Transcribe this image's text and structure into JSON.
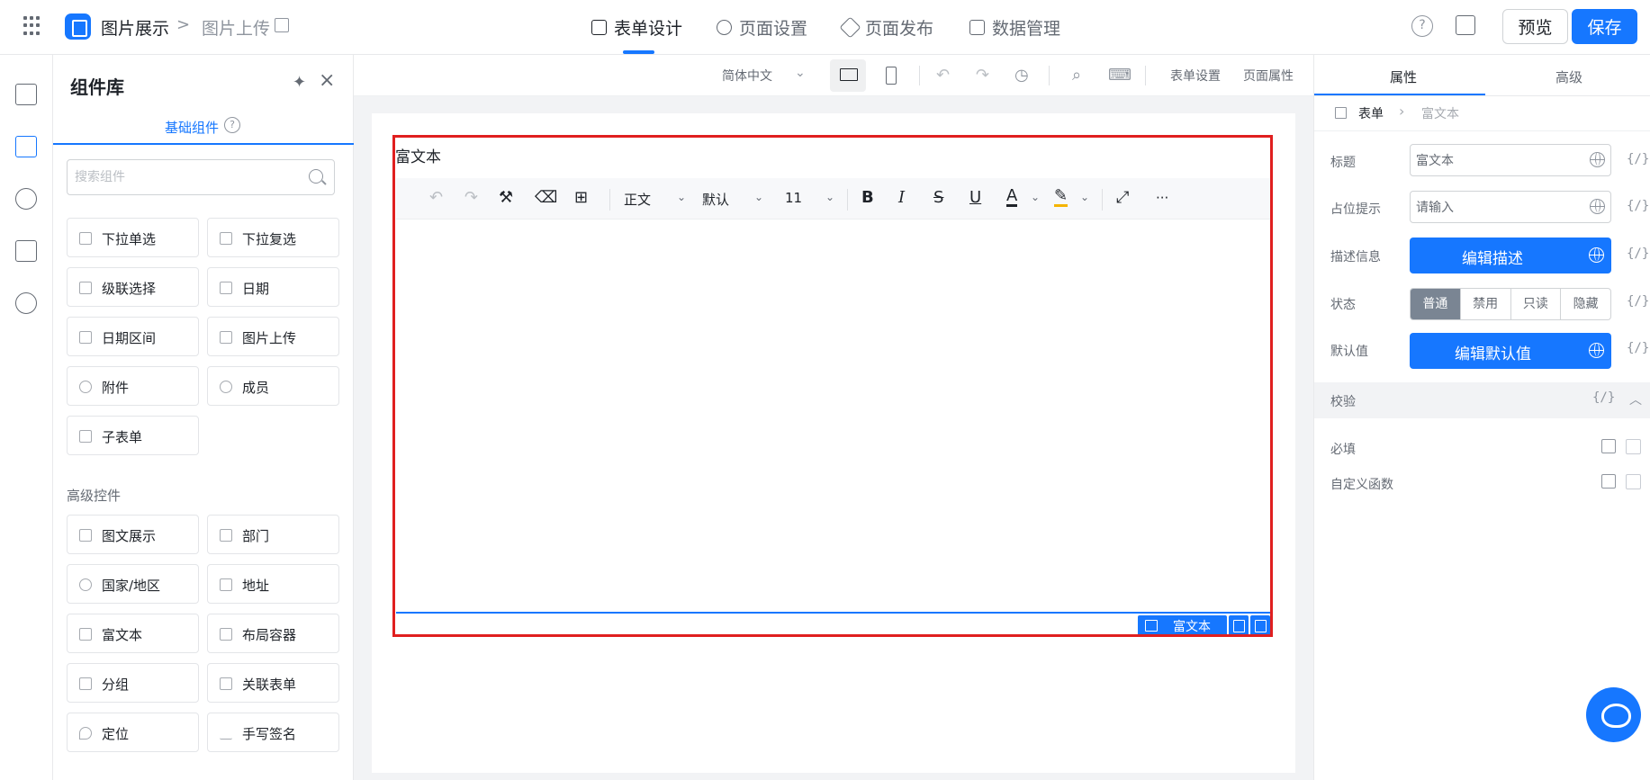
{
  "topbar": {
    "app_name": "图片展示",
    "crumb_sep": ">",
    "page_name": "图片上传",
    "tabs": [
      {
        "label": "表单设计",
        "active": true
      },
      {
        "label": "页面设置",
        "active": false
      },
      {
        "label": "页面发布",
        "active": false
      },
      {
        "label": "数据管理",
        "active": false
      }
    ],
    "preview_label": "预览",
    "save_label": "保存",
    "accent": "#1677ff"
  },
  "library": {
    "title": "组件库",
    "tab_label": "基础组件",
    "search_placeholder": "搜索组件",
    "basic": [
      "下拉单选",
      "下拉复选",
      "级联选择",
      "日期",
      "日期区间",
      "图片上传",
      "附件",
      "成员",
      "子表单"
    ],
    "advanced_title": "高级控件",
    "advanced": [
      "图文展示",
      "部门",
      "国家/地区",
      "地址",
      "富文本",
      "布局容器",
      "分组",
      "关联表单",
      "定位",
      "手写签名"
    ]
  },
  "toolbar": {
    "language": "简体中文",
    "form_settings": "表单设置",
    "page_props": "页面属性"
  },
  "canvas": {
    "field_label": "富文本",
    "rte": {
      "paragraph": "正文",
      "font": "默认",
      "size": "11",
      "more": "···"
    },
    "badge_label": "富文本",
    "selection_color": "#e01f1f"
  },
  "props": {
    "tab_props": "属性",
    "tab_advanced": "高级",
    "crumb_form": "表单",
    "crumb_field": "富文本",
    "title_label": "标题",
    "title_value": "富文本",
    "placeholder_label": "占位提示",
    "placeholder_value": "请输入",
    "desc_label": "描述信息",
    "desc_btn": "编辑描述",
    "state_label": "状态",
    "states": [
      "普通",
      "禁用",
      "只读",
      "隐藏"
    ],
    "default_label": "默认值",
    "default_btn": "编辑默认值",
    "fx": "{/}",
    "validate_label": "校验",
    "required_label": "必填",
    "custom_fn_label": "自定义函数"
  }
}
